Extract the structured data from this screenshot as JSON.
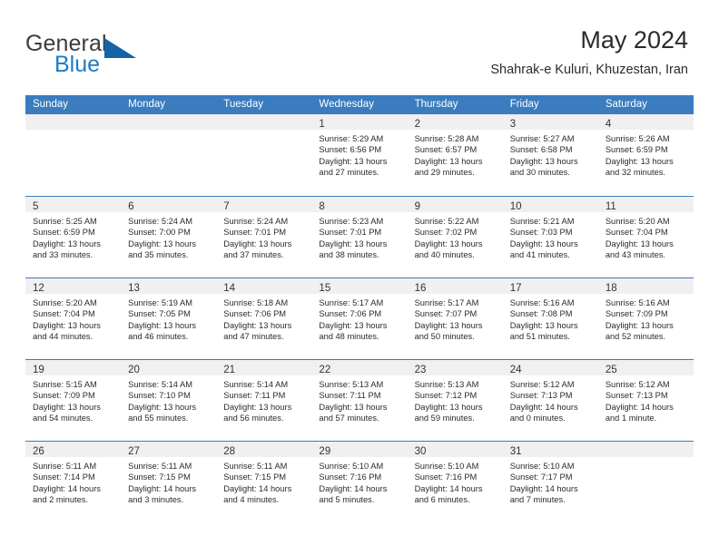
{
  "brand": {
    "name_top": "General",
    "name_bottom": "Blue",
    "accent_color": "#1d7cc4"
  },
  "header": {
    "title": "May 2024",
    "subtitle": "Shahrak-e Kuluri, Khuzestan, Iran"
  },
  "theme": {
    "header_blue": "#3a7cbe",
    "day_band_gray": "#f0f0f0",
    "text_color": "#2b2b2b"
  },
  "weekdays": [
    "Sunday",
    "Monday",
    "Tuesday",
    "Wednesday",
    "Thursday",
    "Friday",
    "Saturday"
  ],
  "weeks": [
    [
      {
        "day": "",
        "sunrise": "",
        "sunset": "",
        "daylight": "",
        "empty": true
      },
      {
        "day": "",
        "sunrise": "",
        "sunset": "",
        "daylight": "",
        "empty": true
      },
      {
        "day": "",
        "sunrise": "",
        "sunset": "",
        "daylight": "",
        "empty": true
      },
      {
        "day": "1",
        "sunrise": "Sunrise: 5:29 AM",
        "sunset": "Sunset: 6:56 PM",
        "daylight": "Daylight: 13 hours and 27 minutes."
      },
      {
        "day": "2",
        "sunrise": "Sunrise: 5:28 AM",
        "sunset": "Sunset: 6:57 PM",
        "daylight": "Daylight: 13 hours and 29 minutes."
      },
      {
        "day": "3",
        "sunrise": "Sunrise: 5:27 AM",
        "sunset": "Sunset: 6:58 PM",
        "daylight": "Daylight: 13 hours and 30 minutes."
      },
      {
        "day": "4",
        "sunrise": "Sunrise: 5:26 AM",
        "sunset": "Sunset: 6:59 PM",
        "daylight": "Daylight: 13 hours and 32 minutes."
      }
    ],
    [
      {
        "day": "5",
        "sunrise": "Sunrise: 5:25 AM",
        "sunset": "Sunset: 6:59 PM",
        "daylight": "Daylight: 13 hours and 33 minutes."
      },
      {
        "day": "6",
        "sunrise": "Sunrise: 5:24 AM",
        "sunset": "Sunset: 7:00 PM",
        "daylight": "Daylight: 13 hours and 35 minutes."
      },
      {
        "day": "7",
        "sunrise": "Sunrise: 5:24 AM",
        "sunset": "Sunset: 7:01 PM",
        "daylight": "Daylight: 13 hours and 37 minutes."
      },
      {
        "day": "8",
        "sunrise": "Sunrise: 5:23 AM",
        "sunset": "Sunset: 7:01 PM",
        "daylight": "Daylight: 13 hours and 38 minutes."
      },
      {
        "day": "9",
        "sunrise": "Sunrise: 5:22 AM",
        "sunset": "Sunset: 7:02 PM",
        "daylight": "Daylight: 13 hours and 40 minutes."
      },
      {
        "day": "10",
        "sunrise": "Sunrise: 5:21 AM",
        "sunset": "Sunset: 7:03 PM",
        "daylight": "Daylight: 13 hours and 41 minutes."
      },
      {
        "day": "11",
        "sunrise": "Sunrise: 5:20 AM",
        "sunset": "Sunset: 7:04 PM",
        "daylight": "Daylight: 13 hours and 43 minutes."
      }
    ],
    [
      {
        "day": "12",
        "sunrise": "Sunrise: 5:20 AM",
        "sunset": "Sunset: 7:04 PM",
        "daylight": "Daylight: 13 hours and 44 minutes."
      },
      {
        "day": "13",
        "sunrise": "Sunrise: 5:19 AM",
        "sunset": "Sunset: 7:05 PM",
        "daylight": "Daylight: 13 hours and 46 minutes."
      },
      {
        "day": "14",
        "sunrise": "Sunrise: 5:18 AM",
        "sunset": "Sunset: 7:06 PM",
        "daylight": "Daylight: 13 hours and 47 minutes."
      },
      {
        "day": "15",
        "sunrise": "Sunrise: 5:17 AM",
        "sunset": "Sunset: 7:06 PM",
        "daylight": "Daylight: 13 hours and 48 minutes."
      },
      {
        "day": "16",
        "sunrise": "Sunrise: 5:17 AM",
        "sunset": "Sunset: 7:07 PM",
        "daylight": "Daylight: 13 hours and 50 minutes."
      },
      {
        "day": "17",
        "sunrise": "Sunrise: 5:16 AM",
        "sunset": "Sunset: 7:08 PM",
        "daylight": "Daylight: 13 hours and 51 minutes."
      },
      {
        "day": "18",
        "sunrise": "Sunrise: 5:16 AM",
        "sunset": "Sunset: 7:09 PM",
        "daylight": "Daylight: 13 hours and 52 minutes."
      }
    ],
    [
      {
        "day": "19",
        "sunrise": "Sunrise: 5:15 AM",
        "sunset": "Sunset: 7:09 PM",
        "daylight": "Daylight: 13 hours and 54 minutes."
      },
      {
        "day": "20",
        "sunrise": "Sunrise: 5:14 AM",
        "sunset": "Sunset: 7:10 PM",
        "daylight": "Daylight: 13 hours and 55 minutes."
      },
      {
        "day": "21",
        "sunrise": "Sunrise: 5:14 AM",
        "sunset": "Sunset: 7:11 PM",
        "daylight": "Daylight: 13 hours and 56 minutes."
      },
      {
        "day": "22",
        "sunrise": "Sunrise: 5:13 AM",
        "sunset": "Sunset: 7:11 PM",
        "daylight": "Daylight: 13 hours and 57 minutes."
      },
      {
        "day": "23",
        "sunrise": "Sunrise: 5:13 AM",
        "sunset": "Sunset: 7:12 PM",
        "daylight": "Daylight: 13 hours and 59 minutes."
      },
      {
        "day": "24",
        "sunrise": "Sunrise: 5:12 AM",
        "sunset": "Sunset: 7:13 PM",
        "daylight": "Daylight: 14 hours and 0 minutes."
      },
      {
        "day": "25",
        "sunrise": "Sunrise: 5:12 AM",
        "sunset": "Sunset: 7:13 PM",
        "daylight": "Daylight: 14 hours and 1 minute."
      }
    ],
    [
      {
        "day": "26",
        "sunrise": "Sunrise: 5:11 AM",
        "sunset": "Sunset: 7:14 PM",
        "daylight": "Daylight: 14 hours and 2 minutes."
      },
      {
        "day": "27",
        "sunrise": "Sunrise: 5:11 AM",
        "sunset": "Sunset: 7:15 PM",
        "daylight": "Daylight: 14 hours and 3 minutes."
      },
      {
        "day": "28",
        "sunrise": "Sunrise: 5:11 AM",
        "sunset": "Sunset: 7:15 PM",
        "daylight": "Daylight: 14 hours and 4 minutes."
      },
      {
        "day": "29",
        "sunrise": "Sunrise: 5:10 AM",
        "sunset": "Sunset: 7:16 PM",
        "daylight": "Daylight: 14 hours and 5 minutes."
      },
      {
        "day": "30",
        "sunrise": "Sunrise: 5:10 AM",
        "sunset": "Sunset: 7:16 PM",
        "daylight": "Daylight: 14 hours and 6 minutes."
      },
      {
        "day": "31",
        "sunrise": "Sunrise: 5:10 AM",
        "sunset": "Sunset: 7:17 PM",
        "daylight": "Daylight: 14 hours and 7 minutes."
      },
      {
        "day": "",
        "sunrise": "",
        "sunset": "",
        "daylight": "",
        "empty": true
      }
    ]
  ]
}
